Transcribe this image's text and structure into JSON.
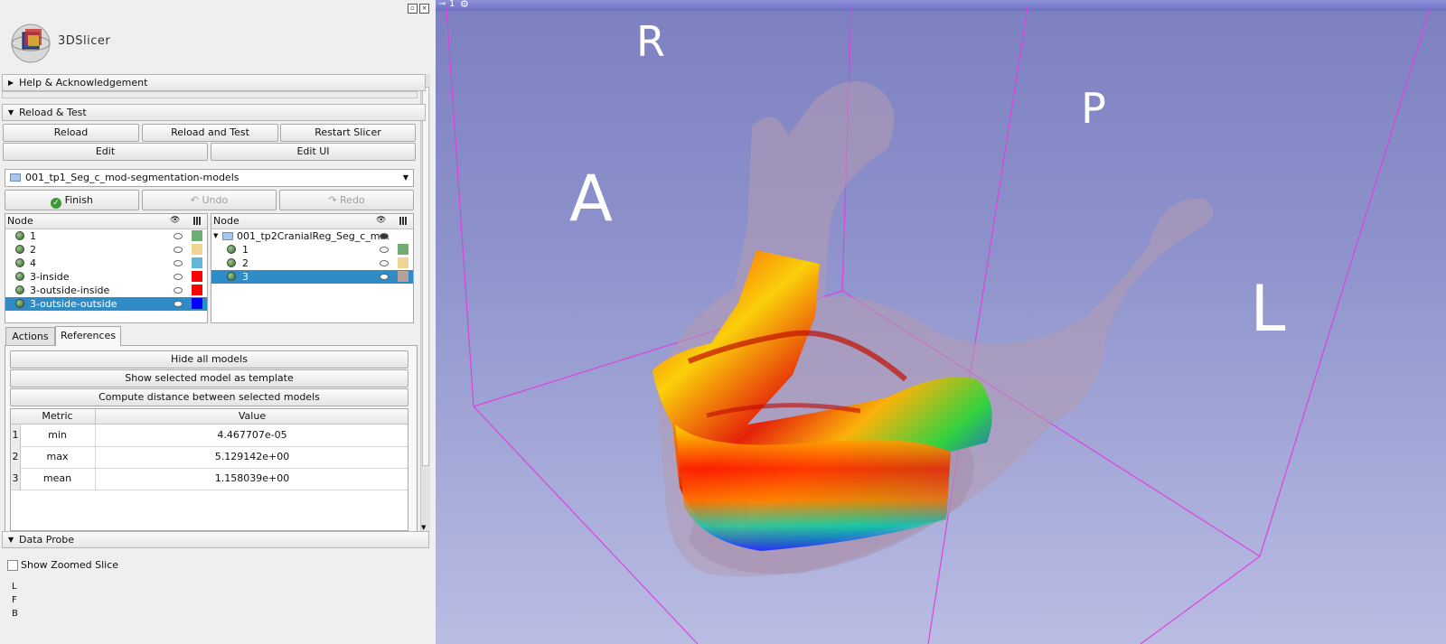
{
  "app": {
    "logo_text": "3DSlicer"
  },
  "sections": {
    "help": "Help & Acknowledgement",
    "reload": "Reload & Test",
    "probe": "Data Probe"
  },
  "reload_buttons": {
    "reload": "Reload",
    "reload_test": "Reload and Test",
    "restart": "Restart Slicer",
    "edit": "Edit",
    "edit_ui": "Edit UI"
  },
  "model_select": {
    "value": "001_tp1_Seg_c_mod-segmentation-models"
  },
  "edit_buttons": {
    "finish": "Finish",
    "undo": "Undo",
    "redo": "Redo"
  },
  "left_tree": {
    "header": "Node",
    "rows": [
      {
        "label": "1",
        "color": "#6fad73"
      },
      {
        "label": "2",
        "color": "#efd593"
      },
      {
        "label": "4",
        "color": "#64b6d6"
      },
      {
        "label": "3-inside",
        "color": "#ff0000"
      },
      {
        "label": "3-outside-inside",
        "color": "#ff0000"
      },
      {
        "label": "3-outside-outside",
        "color": "#0000ff"
      }
    ]
  },
  "right_tree": {
    "header": "Node",
    "parent": "001_tp2CranialReg_Seg_c_m...",
    "rows": [
      {
        "label": "1",
        "color": "#6fad73"
      },
      {
        "label": "2",
        "color": "#efd593"
      },
      {
        "label": "3",
        "color": "#b8a09a"
      }
    ]
  },
  "tabs": {
    "actions": "Actions",
    "references": "References"
  },
  "ref_buttons": {
    "hide_all": "Hide all models",
    "show_template": "Show selected model as template",
    "compute": "Compute distance between selected models"
  },
  "metrics": {
    "headers": [
      "Metric",
      "Value"
    ],
    "rows": [
      {
        "idx": "1",
        "metric": "min",
        "value": "4.467707e-05"
      },
      {
        "idx": "2",
        "metric": "max",
        "value": "5.129142e+00"
      },
      {
        "idx": "3",
        "metric": "mean",
        "value": "1.158039e+00"
      }
    ]
  },
  "probe": {
    "checkbox": "Show Zoomed Slice",
    "lines": [
      "L",
      "F",
      "B"
    ]
  },
  "view": {
    "tab": "1",
    "orientation": {
      "r": "R",
      "p": "P",
      "a": "A",
      "l": "L"
    }
  }
}
